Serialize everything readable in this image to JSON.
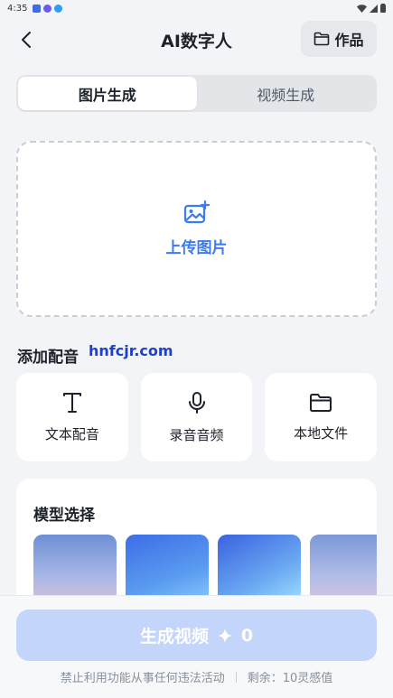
{
  "status_bar": {
    "time": "4:35"
  },
  "header": {
    "title": "AI数字人",
    "works_label": "作品"
  },
  "tabs": [
    {
      "label": "图片生成",
      "active": true
    },
    {
      "label": "视频生成",
      "active": false
    }
  ],
  "upload": {
    "label": "上传图片"
  },
  "voice_section": {
    "title": "添加配音",
    "watermark": "hnfcjr.com",
    "options": [
      {
        "label": "文本配音",
        "icon": "text-icon"
      },
      {
        "label": "录音音频",
        "icon": "microphone-icon"
      },
      {
        "label": "本地文件",
        "icon": "folder-icon"
      }
    ]
  },
  "model_section": {
    "title": "模型选择"
  },
  "generate": {
    "label": "生成视频",
    "cost": "0"
  },
  "footer": {
    "notice": "禁止利用功能从事任何违法活动",
    "remaining": "剩余：10灵感值"
  },
  "colors": {
    "accent": "#3b7cf0",
    "generate_disabled": "#c4d5fb",
    "background": "#f2f4f7"
  }
}
